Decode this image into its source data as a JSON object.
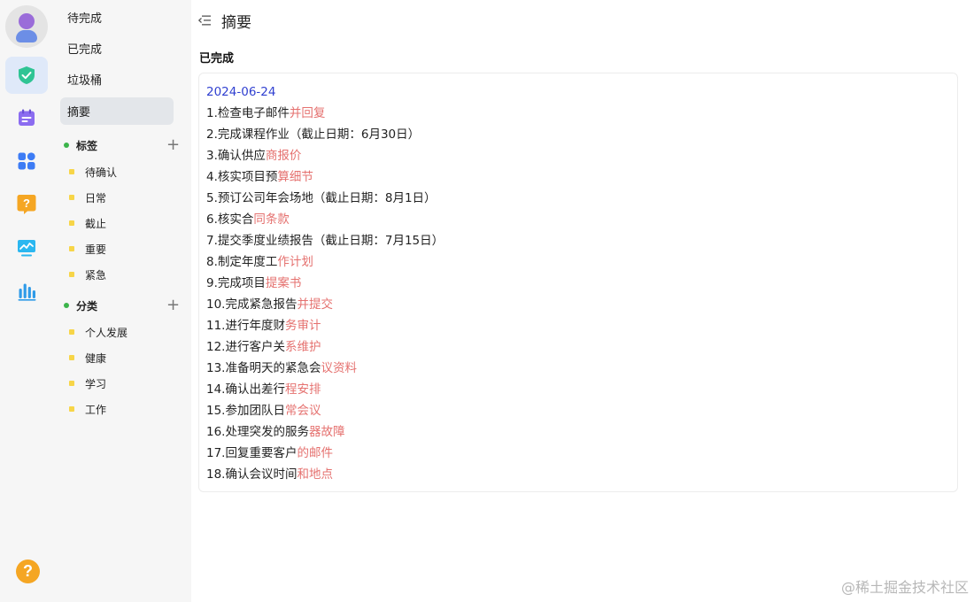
{
  "colors": {
    "accent_green": "#2fc494",
    "highlight_red": "#e5716f",
    "date_blue": "#2f3fd0",
    "help_orange": "#f5a623"
  },
  "rail": {
    "icons": [
      "avatar",
      "check-shield-icon",
      "calendar-icon",
      "apps-grid-icon",
      "question-chat-icon",
      "monitor-chart-icon",
      "bar-chart-icon",
      "help-icon"
    ],
    "help_glyph": "?"
  },
  "nav": {
    "items": [
      {
        "label": "待完成"
      },
      {
        "label": "已完成"
      },
      {
        "label": "垃圾桶"
      },
      {
        "label": "摘要",
        "active": true
      }
    ]
  },
  "tags": {
    "title": "标签",
    "add_glyph": "+",
    "items": [
      {
        "label": "待确认"
      },
      {
        "label": "日常"
      },
      {
        "label": "截止"
      },
      {
        "label": "重要"
      },
      {
        "label": "紧急"
      }
    ]
  },
  "categories": {
    "title": "分类",
    "add_glyph": "+",
    "items": [
      {
        "label": "个人发展"
      },
      {
        "label": "健康"
      },
      {
        "label": "学习"
      },
      {
        "label": "工作"
      }
    ]
  },
  "header": {
    "title": "摘要"
  },
  "summary": {
    "section_title": "已完成",
    "date": "2024-06-24",
    "lines": [
      {
        "black": "1.检查电子邮件",
        "red": "并回复"
      },
      {
        "black": "2.完成课程作业（截止日期：6月30日）",
        "red": ""
      },
      {
        "black": "3.确认供应",
        "red": "商报价"
      },
      {
        "black": "4.核实项目预",
        "red": "算细节"
      },
      {
        "black": "5.预订公司年会场地（截止日期：8月1日）",
        "red": ""
      },
      {
        "black": "6.核实合",
        "red": "同条款"
      },
      {
        "black": "7.提交季度业绩报告（截止日期：7月15日）",
        "red": ""
      },
      {
        "black": "8.制定年度工",
        "red": "作计划"
      },
      {
        "black": "9.完成项目",
        "red": "提案书"
      },
      {
        "black": "10.完成紧急报告",
        "red": "并提交"
      },
      {
        "black": "11.进行年度财",
        "red": "务审计"
      },
      {
        "black": "12.进行客户关",
        "red": "系维护"
      },
      {
        "black": "13.准备明天的紧急会",
        "red": "议资料"
      },
      {
        "black": "14.确认出差行",
        "red": "程安排"
      },
      {
        "black": "15.参加团队日",
        "red": "常会议"
      },
      {
        "black": "16.处理突发的服务",
        "red": "器故障"
      },
      {
        "black": "17.回复重要客户",
        "red": "的邮件"
      },
      {
        "black": "18.确认会议时间",
        "red": "和地点"
      }
    ]
  },
  "watermark": "@稀土掘金技术社区"
}
